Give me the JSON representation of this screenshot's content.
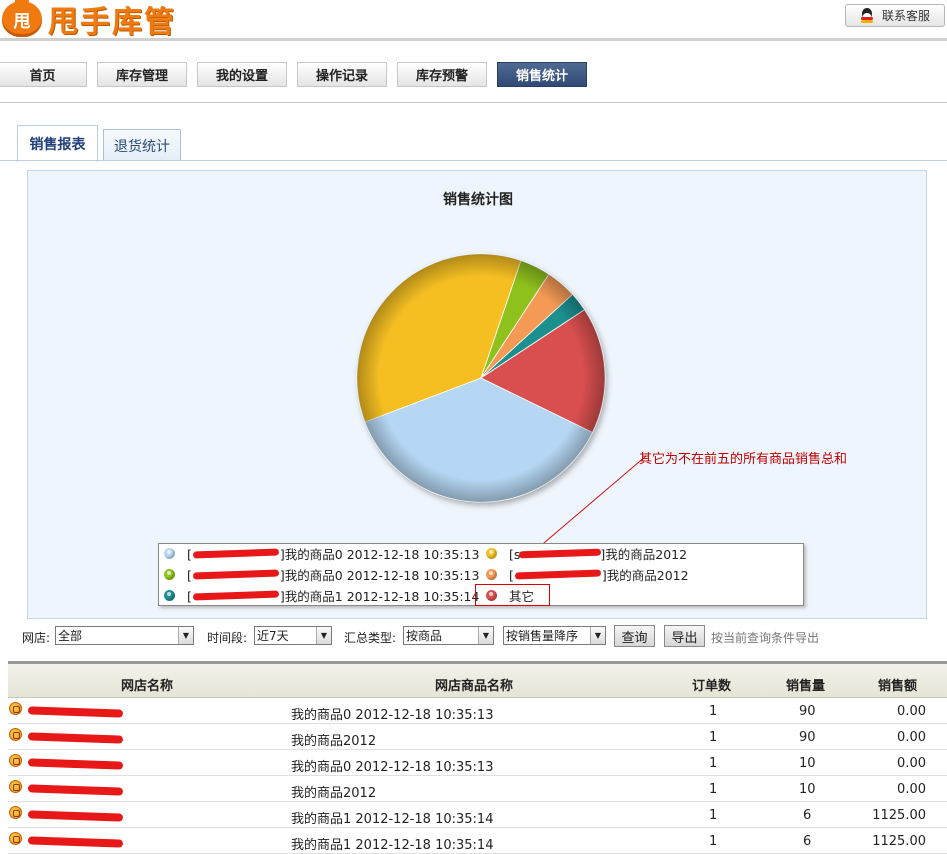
{
  "header": {
    "logo_glyph": "甩",
    "brand": "甩手库管",
    "contact_label": "联系客服"
  },
  "nav": {
    "items": [
      {
        "label": "首页"
      },
      {
        "label": "库存管理"
      },
      {
        "label": "我的设置"
      },
      {
        "label": "操作记录"
      },
      {
        "label": "库存预警"
      },
      {
        "label": "销售统计"
      }
    ],
    "active": "销售统计"
  },
  "subtabs": [
    {
      "label": "销售报表",
      "active": true
    },
    {
      "label": "退货统计",
      "active": false
    }
  ],
  "chart_data": {
    "type": "pie",
    "title": "销售统计图",
    "annotation": "其它为不在前五的所有商品销售总和",
    "slices": [
      {
        "label": "[sandbox_zxx]我的商品0 2012-12-18 10:35:13",
        "value": 37,
        "color": "#b5d7f3"
      },
      {
        "label": "[sandbox_zxx]我的商品2012",
        "value": 36,
        "color": "#f5bf22"
      },
      {
        "label": "[sandbox_zxx]我的商品0 2012-12-18 10:35:13",
        "value": 4,
        "color": "#8fc11e"
      },
      {
        "label": "[sandbox_zxx]我的商品2012",
        "value": 4,
        "color": "#f59a55"
      },
      {
        "label": "[sandbox_zxx]我的商品1 2012-12-18 10:35:14",
        "value": 2.5,
        "color": "#1f8f8f"
      },
      {
        "label": "其它",
        "value": 16.5,
        "color": "#d95050"
      }
    ]
  },
  "legend": [
    {
      "prefix": "[",
      "suffix": "]我的商品0 2012-12-18 10:35:13",
      "color": "#b5d7f3"
    },
    {
      "prefix": "[s",
      "suffix": "]我的商品2012",
      "color": "#f5bf22"
    },
    {
      "prefix": "[",
      "suffix": "]我的商品0 2012-12-18 10:35:13",
      "color": "#8fc11e"
    },
    {
      "prefix": "[",
      "suffix": "]我的商品2012",
      "color": "#f59a55"
    },
    {
      "prefix": "[",
      "suffix": "]我的商品1 2012-12-18 10:35:14",
      "color": "#1f8f8f"
    },
    {
      "prefix": "",
      "suffix": "其它",
      "color": "#d95050"
    }
  ],
  "filters": {
    "shop_label": "网店:",
    "shop_value": "全部",
    "period_label": "时间段:",
    "period_value": "近7天",
    "group_label": "汇总类型:",
    "group_value": "按商品",
    "sort_value": "按销售量降序",
    "query_label": "查询",
    "export_label": "导出",
    "hint": "按当前查询条件导出"
  },
  "table": {
    "headers": [
      "网店名称",
      "网店商品名称",
      "订单数",
      "销售量",
      "销售额"
    ],
    "rows": [
      {
        "product": "我的商品0 2012-12-18 10:35:13",
        "orders": "1",
        "qty": "90",
        "amount": "0.00"
      },
      {
        "product": "我的商品2012",
        "orders": "1",
        "qty": "90",
        "amount": "0.00"
      },
      {
        "product": "我的商品0 2012-12-18 10:35:13",
        "orders": "1",
        "qty": "10",
        "amount": "0.00"
      },
      {
        "product": "我的商品2012",
        "orders": "1",
        "qty": "10",
        "amount": "0.00"
      },
      {
        "product": "我的商品1 2012-12-18 10:35:14",
        "orders": "1",
        "qty": "6",
        "amount": "1125.00"
      },
      {
        "product": "我的商品1 2012-12-18 10:35:14",
        "orders": "1",
        "qty": "6",
        "amount": "1125.00"
      }
    ]
  }
}
